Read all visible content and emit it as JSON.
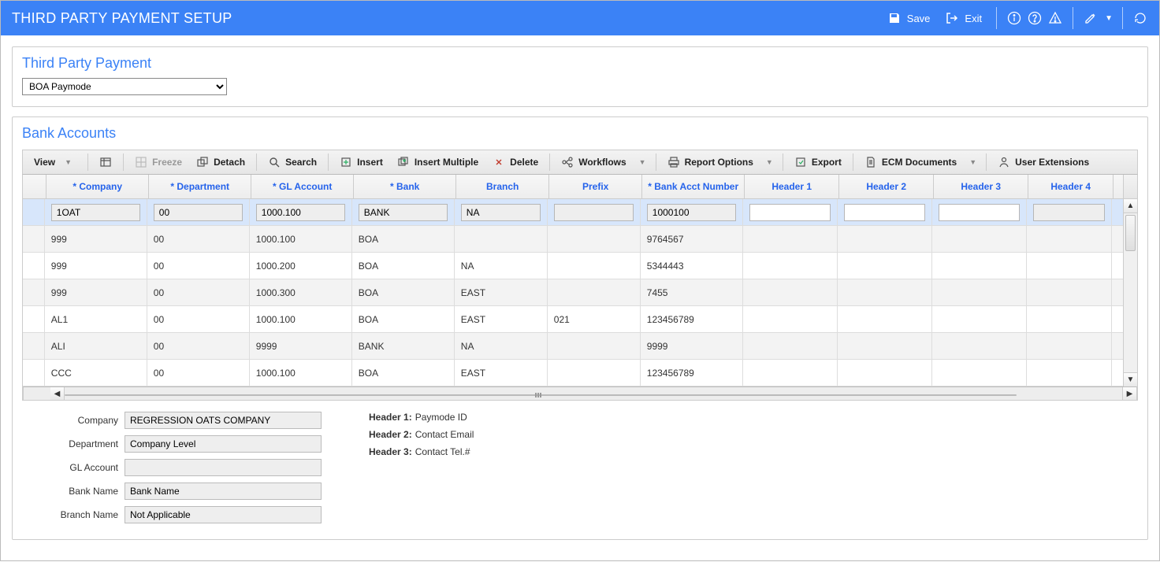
{
  "header": {
    "title": "THIRD PARTY PAYMENT SETUP",
    "save": "Save",
    "exit": "Exit"
  },
  "panel1": {
    "title": "Third Party Payment",
    "selected": "BOA Paymode"
  },
  "panel2": {
    "title": "Bank Accounts",
    "toolbar": {
      "view": "View",
      "freeze": "Freeze",
      "detach": "Detach",
      "search": "Search",
      "insert": "Insert",
      "insertMultiple": "Insert Multiple",
      "delete": "Delete",
      "workflows": "Workflows",
      "reportOptions": "Report Options",
      "export": "Export",
      "ecm": "ECM Documents",
      "userExt": "User Extensions"
    },
    "columns": {
      "company": "* Company",
      "department": "* Department",
      "gl": "* GL Account",
      "bank": "* Bank",
      "branch": "Branch",
      "prefix": "Prefix",
      "acct": "* Bank Acct Number",
      "h1": "Header 1",
      "h2": "Header 2",
      "h3": "Header 3",
      "h4": "Header 4"
    },
    "selectedRow": {
      "company": "1OAT",
      "department": "00",
      "gl": "1000.100",
      "bank": "BANK",
      "branch": "NA",
      "prefix": "",
      "acct": "1000100",
      "h1": "",
      "h2": "",
      "h3": "",
      "h4": ""
    },
    "rows": [
      {
        "company": "999",
        "department": "00",
        "gl": "1000.100",
        "bank": "BOA",
        "branch": "",
        "prefix": "",
        "acct": "9764567"
      },
      {
        "company": "999",
        "department": "00",
        "gl": "1000.200",
        "bank": "BOA",
        "branch": "NA",
        "prefix": "",
        "acct": "5344443"
      },
      {
        "company": "999",
        "department": "00",
        "gl": "1000.300",
        "bank": "BOA",
        "branch": "EAST",
        "prefix": "",
        "acct": "7455"
      },
      {
        "company": "AL1",
        "department": "00",
        "gl": "1000.100",
        "bank": "BOA",
        "branch": "EAST",
        "prefix": "021",
        "acct": "123456789"
      },
      {
        "company": "ALI",
        "department": "00",
        "gl": "9999",
        "bank": "BANK",
        "branch": "NA",
        "prefix": "",
        "acct": "9999"
      },
      {
        "company": "CCC",
        "department": "00",
        "gl": "1000.100",
        "bank": "BOA",
        "branch": "EAST",
        "prefix": "",
        "acct": "123456789"
      }
    ],
    "details": {
      "companyLabel": "Company",
      "company": "REGRESSION OATS COMPANY",
      "deptLabel": "Department",
      "dept": "Company Level",
      "glLabel": "GL Account",
      "gl": "",
      "bankNameLabel": "Bank Name",
      "bankName": "Bank Name",
      "branchNameLabel": "Branch Name",
      "branchName": "Not Applicable",
      "h1Label": "Header 1:",
      "h1": "Paymode ID",
      "h2Label": "Header 2:",
      "h2": "Contact Email",
      "h3Label": "Header 3:",
      "h3": "Contact Tel.#"
    }
  }
}
